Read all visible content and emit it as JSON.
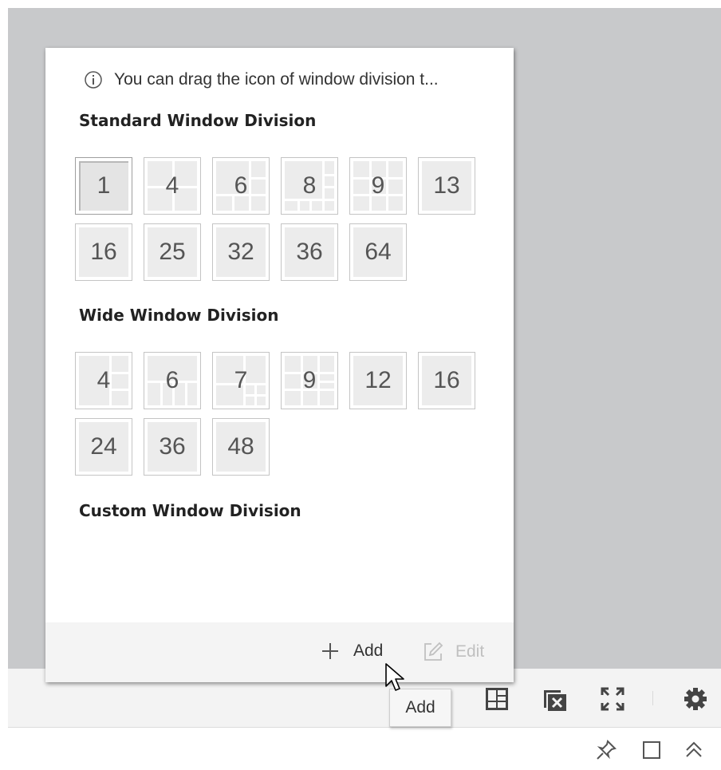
{
  "popup": {
    "info_text": "You can drag the icon of window division t...",
    "standard_title": "Standard Window Division",
    "wide_title": "Wide Window Division",
    "custom_title": "Custom Window Division",
    "standard_divisions": [
      "1",
      "4",
      "6",
      "8",
      "9",
      "13",
      "16",
      "25",
      "32",
      "36",
      "64"
    ],
    "standard_selected": "1",
    "wide_divisions": [
      "4",
      "6",
      "7",
      "9",
      "12",
      "16",
      "24",
      "36",
      "48"
    ],
    "add_label": "Add",
    "edit_label": "Edit"
  },
  "tooltip": {
    "text": "Add"
  },
  "toolbar": {
    "icons": [
      "window-division-icon",
      "close-all-windows-icon",
      "fullscreen-icon",
      "settings-gear-icon"
    ]
  },
  "bottom_bar": {
    "icons": [
      "pin-icon",
      "maximize-icon",
      "collapse-up-icon"
    ]
  },
  "colors": {
    "video_background": "#c8c9cb",
    "cell_fill": "#ececec",
    "cell_border": "#c4c4c4",
    "disabled_text": "#c0c0c0"
  }
}
